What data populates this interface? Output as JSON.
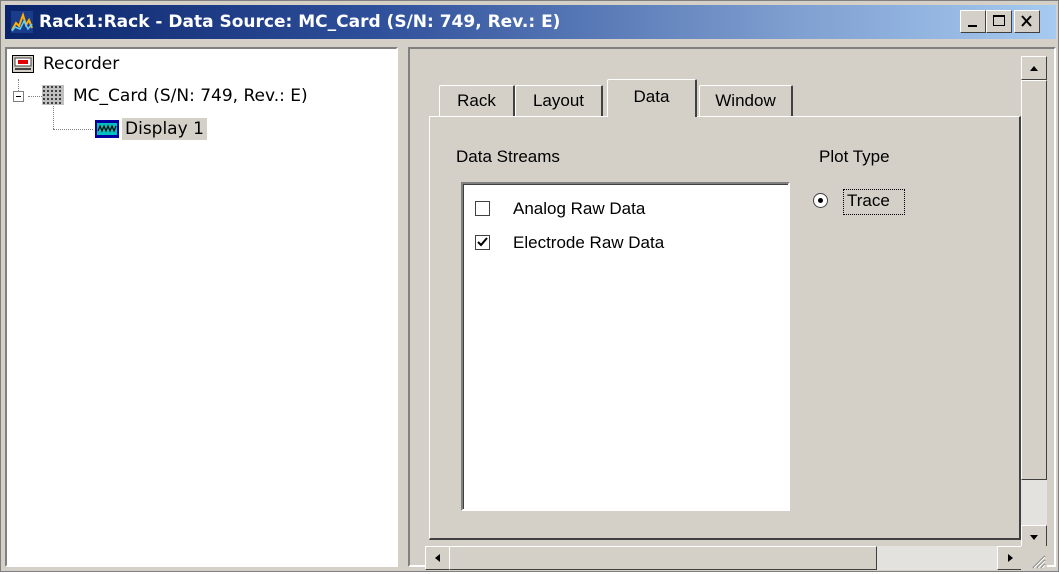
{
  "window": {
    "title": "Rack1:Rack - Data Source: MC_Card (S/N: 749, Rev.: E)",
    "app_icon": "rack-icon",
    "buttons": {
      "minimize": "minimize-icon",
      "maximize": "maximize-icon",
      "close": "close-icon"
    }
  },
  "tree": {
    "nodes": [
      {
        "label": "Recorder",
        "icon": "recorder-icon",
        "level": 0
      },
      {
        "label": "MC_Card (S/N: 749, Rev.: E)",
        "icon": "card-grid-icon",
        "level": 1,
        "expanded": true
      },
      {
        "label": "Display 1",
        "icon": "display-icon",
        "level": 2,
        "selected": true
      }
    ]
  },
  "tabs": [
    {
      "label": "Rack",
      "active": false
    },
    {
      "label": "Layout",
      "active": false
    },
    {
      "label": "Data",
      "active": true
    },
    {
      "label": "Window",
      "active": false
    }
  ],
  "data_tab": {
    "streams_label": "Data Streams",
    "streams": [
      {
        "label": "Analog Raw Data",
        "checked": false
      },
      {
        "label": "Electrode Raw Data",
        "checked": true
      }
    ],
    "plot_type_label": "Plot Type",
    "plot_types": [
      {
        "label": "Trace",
        "selected": true
      }
    ]
  },
  "colors": {
    "titlebar_start": "#0a246a",
    "titlebar_end": "#a6caf0",
    "face": "#d4d0c8"
  }
}
